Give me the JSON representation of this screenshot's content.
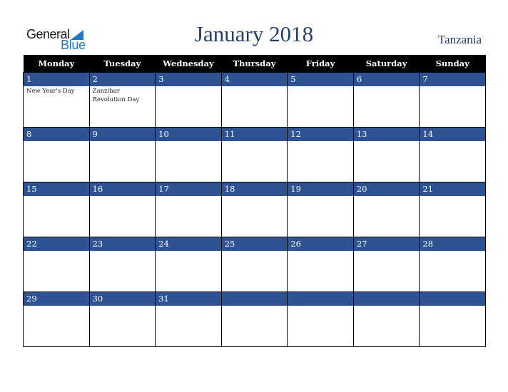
{
  "logo": {
    "line1": "General",
    "line2": "Blue",
    "accent": "#1f78c1"
  },
  "title": "January 2018",
  "country": "Tanzania",
  "colors": {
    "header_bg": "#000000",
    "daynum_bg": "#2d5394",
    "title": "#243f6e"
  },
  "weekdays": [
    "Monday",
    "Tuesday",
    "Wednesday",
    "Thursday",
    "Friday",
    "Saturday",
    "Sunday"
  ],
  "weeks": [
    [
      {
        "day": "1",
        "holiday": "New Year's Day"
      },
      {
        "day": "2",
        "holiday": "Zanzibar Revolution Day"
      },
      {
        "day": "3",
        "holiday": ""
      },
      {
        "day": "4",
        "holiday": ""
      },
      {
        "day": "5",
        "holiday": ""
      },
      {
        "day": "6",
        "holiday": ""
      },
      {
        "day": "7",
        "holiday": ""
      }
    ],
    [
      {
        "day": "8",
        "holiday": ""
      },
      {
        "day": "9",
        "holiday": ""
      },
      {
        "day": "10",
        "holiday": ""
      },
      {
        "day": "11",
        "holiday": ""
      },
      {
        "day": "12",
        "holiday": ""
      },
      {
        "day": "13",
        "holiday": ""
      },
      {
        "day": "14",
        "holiday": ""
      }
    ],
    [
      {
        "day": "15",
        "holiday": ""
      },
      {
        "day": "16",
        "holiday": ""
      },
      {
        "day": "17",
        "holiday": ""
      },
      {
        "day": "18",
        "holiday": ""
      },
      {
        "day": "19",
        "holiday": ""
      },
      {
        "day": "20",
        "holiday": ""
      },
      {
        "day": "21",
        "holiday": ""
      }
    ],
    [
      {
        "day": "22",
        "holiday": ""
      },
      {
        "day": "23",
        "holiday": ""
      },
      {
        "day": "24",
        "holiday": ""
      },
      {
        "day": "25",
        "holiday": ""
      },
      {
        "day": "26",
        "holiday": ""
      },
      {
        "day": "27",
        "holiday": ""
      },
      {
        "day": "28",
        "holiday": ""
      }
    ],
    [
      {
        "day": "29",
        "holiday": ""
      },
      {
        "day": "30",
        "holiday": ""
      },
      {
        "day": "31",
        "holiday": ""
      },
      {
        "day": "",
        "holiday": ""
      },
      {
        "day": "",
        "holiday": ""
      },
      {
        "day": "",
        "holiday": ""
      },
      {
        "day": "",
        "holiday": ""
      }
    ]
  ]
}
